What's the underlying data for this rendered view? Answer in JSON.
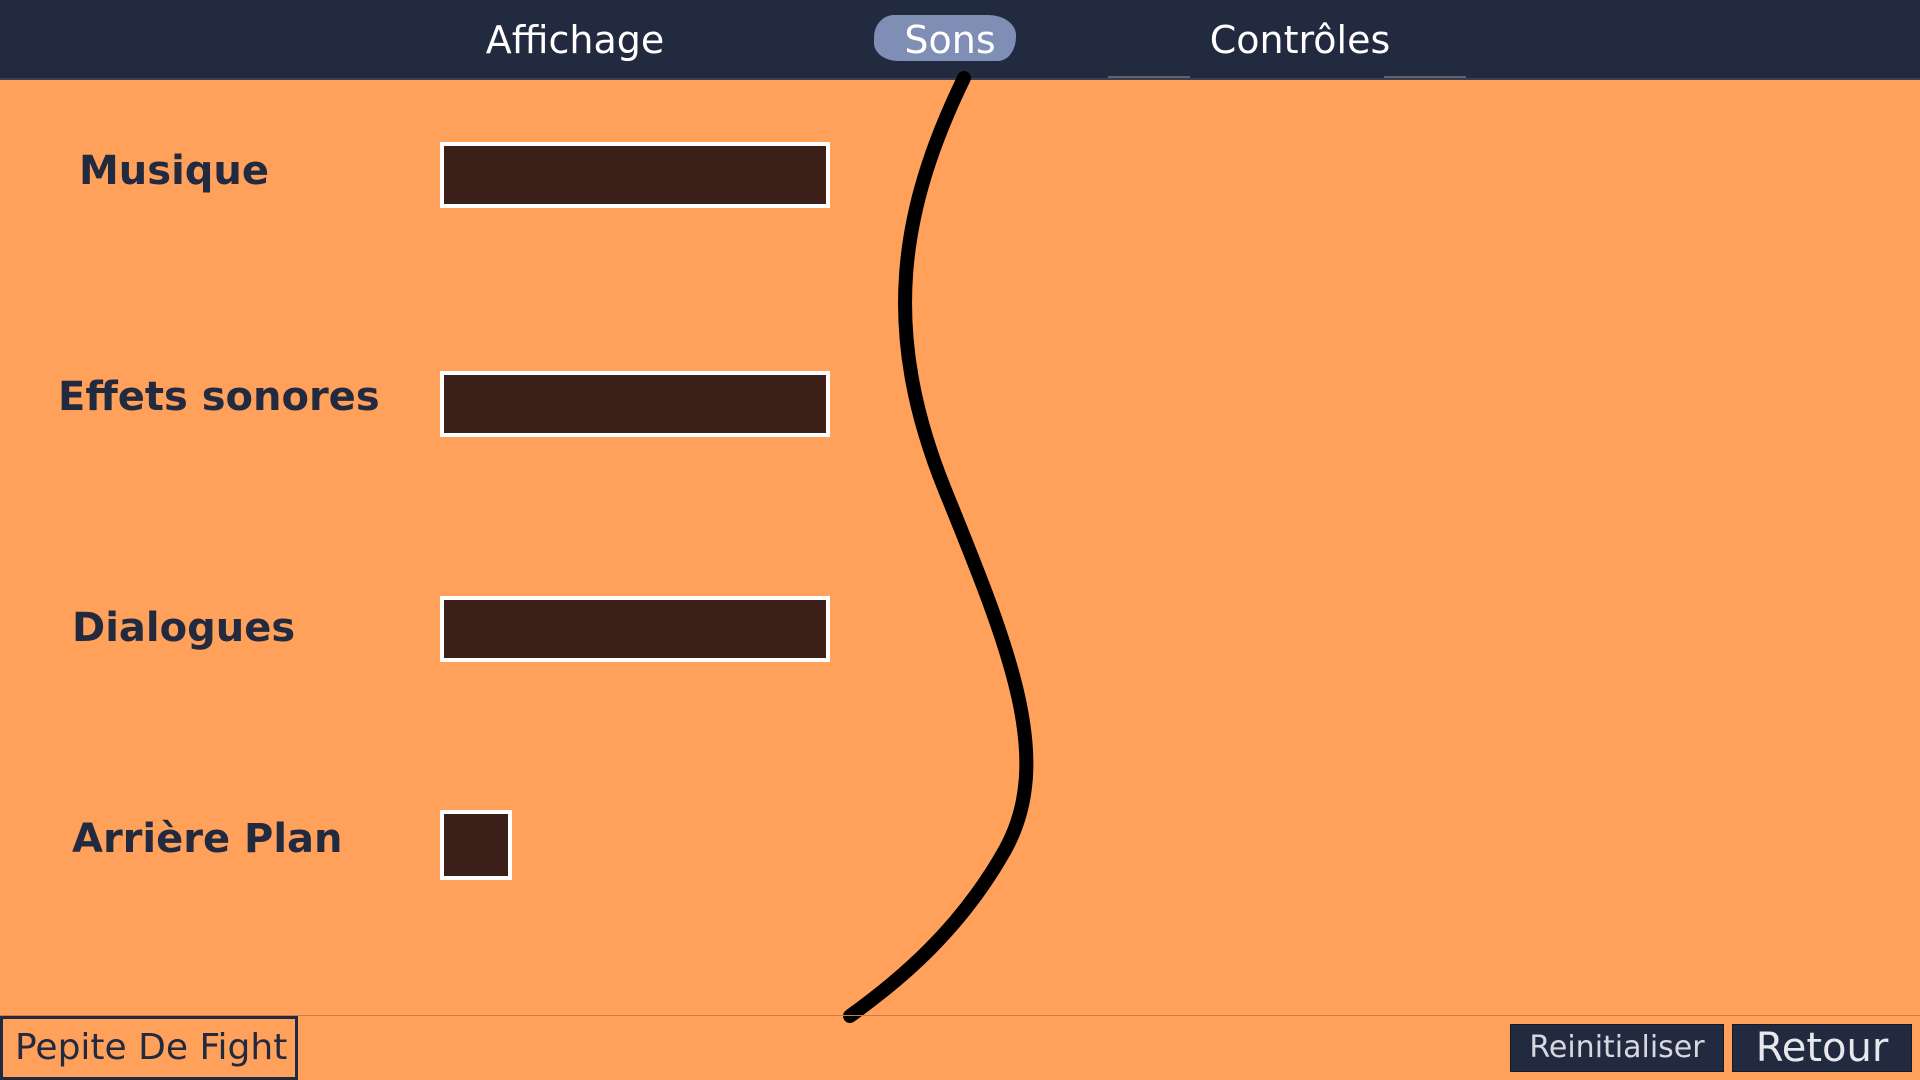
{
  "tabs": {
    "display": "Affichage",
    "sounds": "Sons",
    "controls": "Contrôles",
    "active": "Sons"
  },
  "settings": {
    "music_label": "Musique",
    "effects_label": "Effets sonores",
    "dialogues_label": "Dialogues",
    "background_label": "Arrière Plan"
  },
  "footer": {
    "brand": "Pepite De Fight",
    "reset_label": "Reinitialiser",
    "back_label": "Retour"
  },
  "colors": {
    "background": "#ffa05b",
    "topbar": "#222a3f",
    "active_tab_highlight": "#7f8eb5",
    "slider_fill": "#3a2018",
    "label_text": "#222a3f"
  }
}
